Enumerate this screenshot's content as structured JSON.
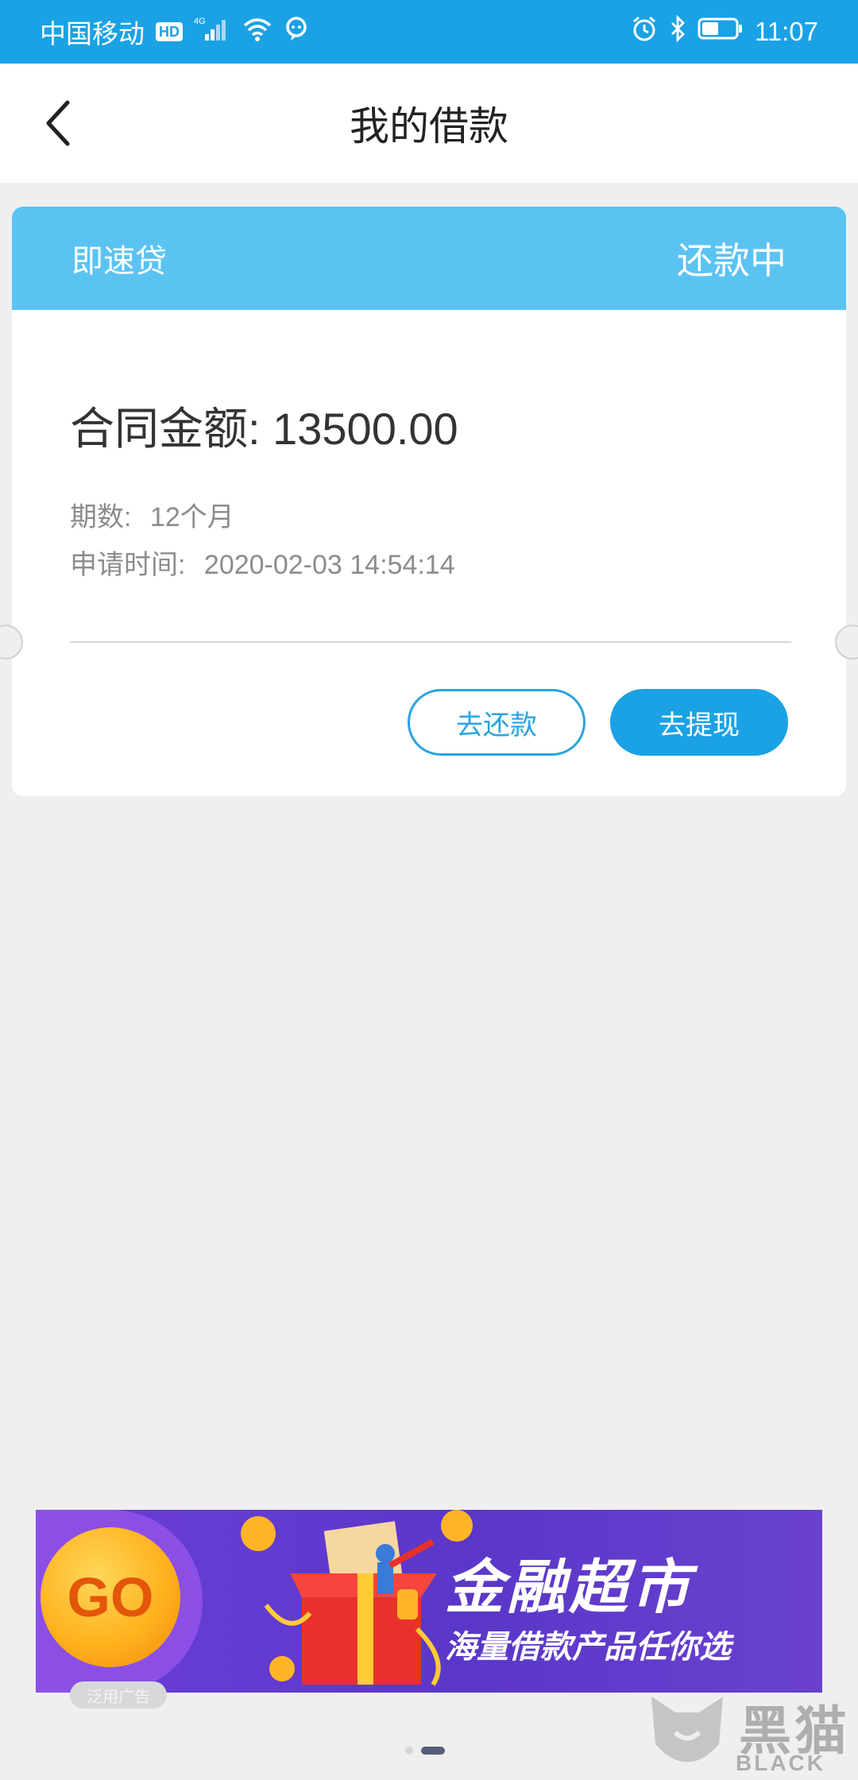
{
  "status_bar": {
    "carrier": "中国移动",
    "hd": "HD",
    "network": "4G",
    "time": "11:07"
  },
  "header": {
    "title": "我的借款"
  },
  "loan_card": {
    "product_name": "即速贷",
    "status": "还款中",
    "contract_label": "合同金额:",
    "contract_amount": "13500.00",
    "periods_label": "期数:",
    "periods_value": "12个月",
    "apply_time_label": "申请时间:",
    "apply_time_value": "2020-02-03 14:54:14",
    "repay_button": "去还款",
    "withdraw_button": "去提现"
  },
  "ad": {
    "go_text": "GO",
    "title": "金融超市",
    "subtitle": "海量借款产品任你选",
    "label": "泛用广告"
  },
  "pager": {
    "pages": 2,
    "active": 2
  },
  "watermark": {
    "cn": "黑猫",
    "en": "BLACK CAT"
  },
  "colors": {
    "status_bar": "#1aa2e5",
    "card_head": "#5bc3f2",
    "accent": "#1aa2e5",
    "ad_purple": "#5a37c9"
  }
}
